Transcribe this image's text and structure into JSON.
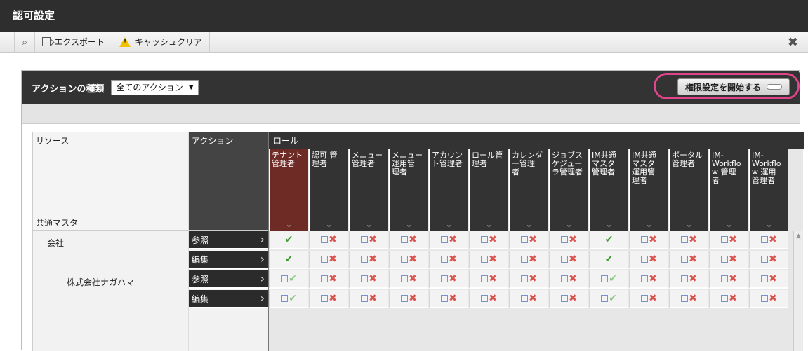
{
  "window": {
    "title": "認可設定"
  },
  "toolbar": {
    "export_label": "エクスポート",
    "cache_clear_label": "キャッシュクリア",
    "close_glyph": "✖",
    "search_glyph": "⌕"
  },
  "panel": {
    "action_type_label": "アクションの種類",
    "action_type_value": "全てのアクション",
    "start_button_label": "権限設定を開始する"
  },
  "table": {
    "resource_header": "リソース",
    "action_header": "アクション",
    "role_header": "ロール",
    "resource_group": "共通マスタ",
    "roles": [
      "テナント\n管理者",
      "認可 管\n理者",
      "メニュー\n管理者",
      "メニュー\n運用管\n理者",
      "アカウン\nト管理者",
      "ロール管\n理者",
      "カレンダ\nー管理\n者",
      "ジョブス\nケジュー\nラ管理者",
      "IM共通\nマスタ\n管理者",
      "IM共通\nマスタ\n運用管\n理者",
      "ポータル\n管理者",
      "IM-\nWorkflo\nw 管理\n者",
      "IM-\nWorkflo\nw 運用\n管理者"
    ],
    "rows": [
      {
        "resource": "会社",
        "action": "参照",
        "cells": [
          "yes",
          "no",
          "no",
          "no",
          "no",
          "no",
          "no",
          "no",
          "yes",
          "no",
          "no",
          "no",
          "no"
        ]
      },
      {
        "resource": "",
        "action": "編集",
        "cells": [
          "yes",
          "no",
          "no",
          "no",
          "no",
          "no",
          "no",
          "no",
          "yes",
          "no",
          "no",
          "no",
          "no"
        ]
      },
      {
        "resource": "株式会社ナガハマ",
        "action": "参照",
        "cells": [
          "inh",
          "no",
          "no",
          "no",
          "no",
          "no",
          "no",
          "no",
          "inh",
          "no",
          "no",
          "no",
          "no"
        ]
      },
      {
        "resource": "",
        "action": "編集",
        "cells": [
          "inh",
          "no",
          "no",
          "no",
          "no",
          "no",
          "no",
          "no",
          "inh",
          "no",
          "no",
          "no",
          "no"
        ]
      }
    ]
  },
  "colors": {
    "active_role": "#6e2a25",
    "allowed": "#3a9b2c",
    "denied": "#d9534f",
    "highlight": "#e0458c"
  }
}
